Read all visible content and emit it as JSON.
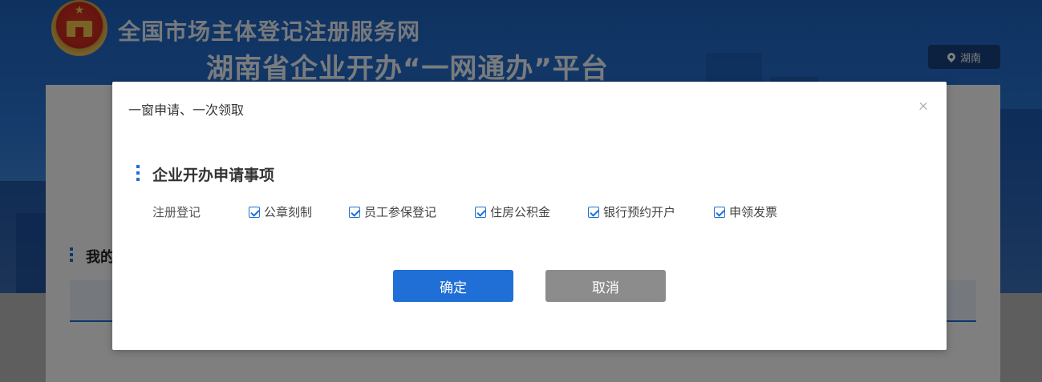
{
  "header": {
    "site_title": "全国市场主体登记注册服务网",
    "platform_title": "湖南省企业开办“一网通办”平台",
    "region": "湖南",
    "region_icon": "location-pin-icon",
    "emblem": "national-emblem"
  },
  "page": {
    "section_title_partial": "我的"
  },
  "modal": {
    "title": "一窗申请、一次领取",
    "close_icon": "close-icon",
    "section_title": "企业开办申请事项",
    "registration_label": "注册登记",
    "options": [
      {
        "label": "公章刻制",
        "checked": true
      },
      {
        "label": "员工参保登记",
        "checked": true
      },
      {
        "label": "住房公积金",
        "checked": true
      },
      {
        "label": "银行预约开户",
        "checked": true
      },
      {
        "label": "申领发票",
        "checked": true
      }
    ],
    "confirm_label": "确定",
    "cancel_label": "取消"
  },
  "colors": {
    "accent": "#1f6fd6",
    "cancel": "#8c8c8c",
    "header_bg": "#2a78d8"
  }
}
